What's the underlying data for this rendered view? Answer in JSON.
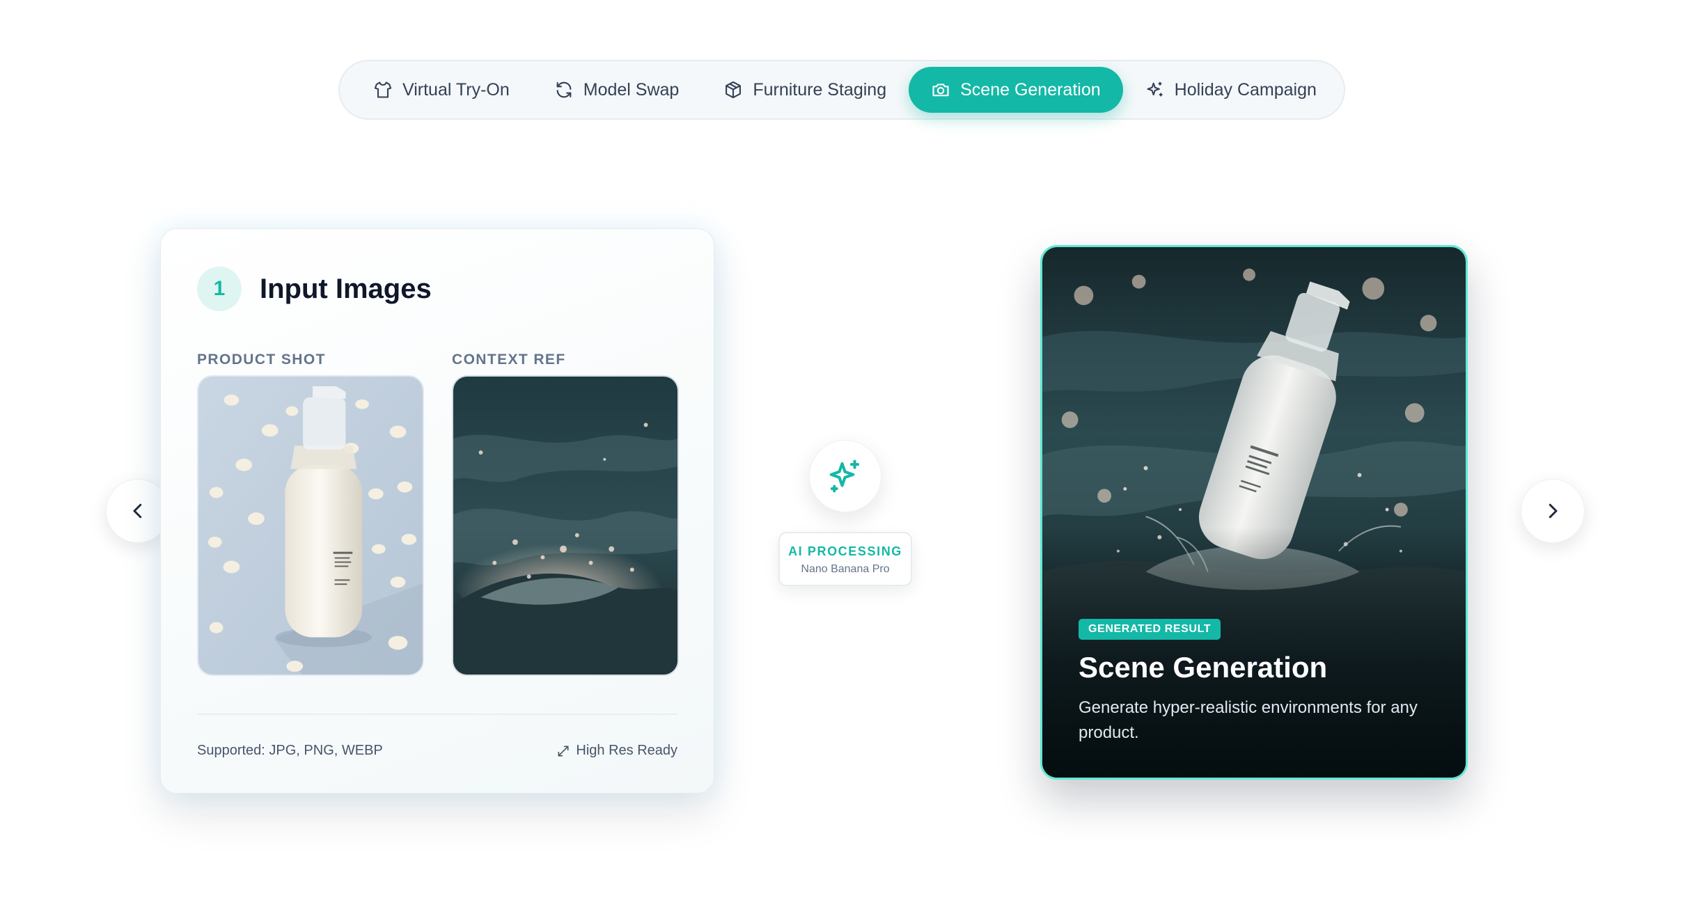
{
  "tabs": [
    {
      "label": "Virtual Try-On",
      "icon": "shirt-icon",
      "active": false
    },
    {
      "label": "Model Swap",
      "icon": "refresh-icon",
      "active": false
    },
    {
      "label": "Furniture Staging",
      "icon": "box-icon",
      "active": false
    },
    {
      "label": "Scene Generation",
      "icon": "camera-icon",
      "active": true
    },
    {
      "label": "Holiday Campaign",
      "icon": "sparkles-icon",
      "active": false
    }
  ],
  "input_card": {
    "step": "1",
    "title": "Input Images",
    "product_label": "PRODUCT SHOT",
    "context_label": "CONTEXT REF",
    "supported": "Supported: JPG, PNG, WEBP",
    "high_res": "High Res Ready"
  },
  "ai": {
    "title": "AI PROCESSING",
    "model": "Nano Banana Pro"
  },
  "result": {
    "badge": "GENERATED RESULT",
    "title": "Scene Generation",
    "description": "Generate hyper-realistic environments for any product."
  },
  "product": {
    "brand": "Glossier.",
    "name_line1": "milky jelly",
    "name_line2": "cleanser"
  },
  "colors": {
    "accent": "#14b8a6",
    "accent_light": "#5eead4"
  }
}
